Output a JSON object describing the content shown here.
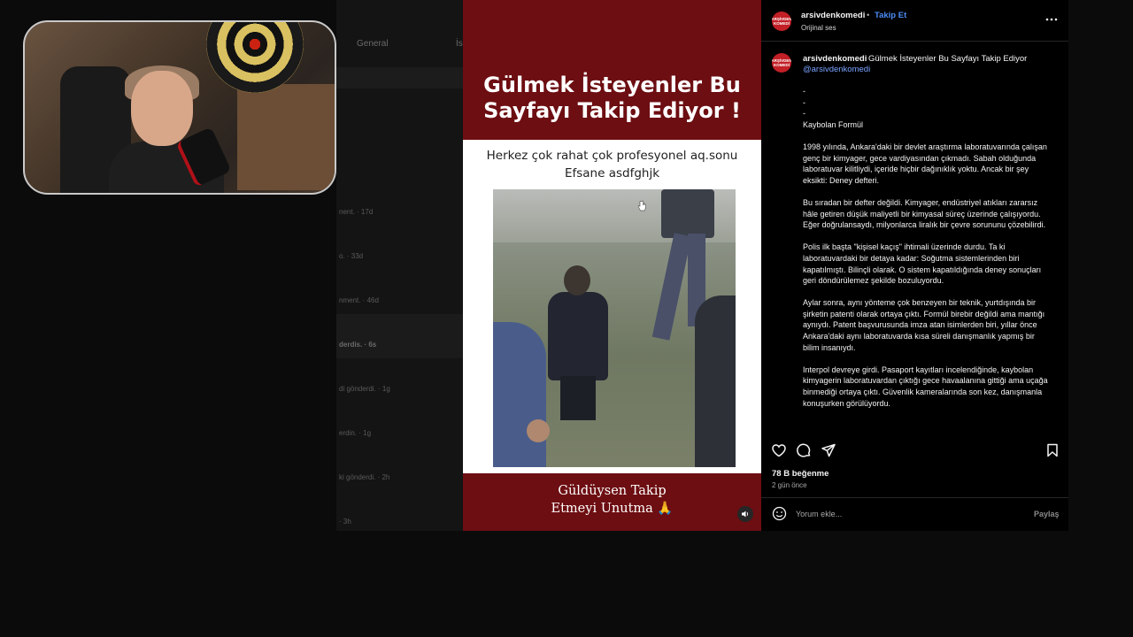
{
  "background": {
    "tabs": [
      "General",
      "İs"
    ],
    "notifications": [
      "nent. · 17d",
      "o. · 33d",
      "nment. · 46d",
      "derdis. · 6s",
      "di gönderdi. · 1g",
      "erdin. · 1g",
      "ki gönderdi. · 2h",
      "· 3h"
    ]
  },
  "post": {
    "title_line1": "Gülmek İsteyenler Bu",
    "title_line2": "Sayfayı Takip Ediyor !",
    "caption_line1": "Herkez çok rahat çok profesyonel aq.sonu",
    "caption_line2": "Efsane asdfghjk",
    "cta_line1": "Güldüysen Takip",
    "cta_line2": "Etmeyi Unutma 🙏",
    "mute_icon": "speaker-icon"
  },
  "sidebar": {
    "header": {
      "username": "arsivdenkomedi",
      "separator": "•",
      "follow_label": "Takip Et",
      "audio_label": "Orijinal ses",
      "avatar_text": "ARŞİVDEN KOMEDİ"
    },
    "caption": {
      "username": "arsivdenkomedi",
      "headline": "Gülmek İsteyenler Bu Sayfayı Takip Ediyor",
      "mention": "@arsivdenkomedi",
      "dashes": [
        "-",
        "-",
        "-"
      ],
      "title": "Kaybolan Formül",
      "paragraphs": [
        "1998 yılında, Ankara'daki bir devlet araştırma laboratuvarında çalışan genç bir kimyager, gece vardiyasından çıkmadı. Sabah olduğunda laboratuvar kilitliydi, içeride hiçbir dağınıklık yoktu. Ancak bir şey eksikti: Deney defteri.",
        "Bu sıradan bir defter değildi. Kimyager, endüstriyel atıkları zararsız hâle getiren düşük maliyetli bir kimyasal süreç üzerinde çalışıyordu. Eğer doğrulansaydı, milyonlarca liralık bir çevre sorununu çözebilirdi.",
        "Polis ilk başta \"kişisel kaçış\" ihtimali üzerinde durdu. Ta ki laboratuvardaki bir detaya kadar: Soğutma sistemlerinden biri kapatılmıştı. Bilinçli olarak. O sistem kapatıldığında deney sonuçları geri döndürülemez şekilde bozuluyordu.",
        "Aylar sonra, aynı yönteme çok benzeyen bir teknik, yurtdışında bir şirketin patenti olarak ortaya çıktı. Formül birebir değildi ama mantığı aynıydı. Patent başvurusunda imza atan isimlerden biri, yıllar önce Ankara'daki aynı laboratuvarda kısa süreli danışmanlık yapmış bir bilim insanıydı.",
        "Interpol devreye girdi. Pasaport kayıtları incelendiğinde, kaybolan kimyagerin laboratuvardan çıktığı gece havaalanına gittiği ama uçağa binmediği ortaya çıktı. Güvenlik kameralarında son kez, danışmanla konuşurken görülüyordu."
      ]
    },
    "actions": {
      "like_icon": "heart-icon",
      "comment_icon": "comment-icon",
      "share_icon": "send-icon",
      "save_icon": "bookmark-icon"
    },
    "likes": "78 B beğenme",
    "time": "2 gün önce",
    "comment_placeholder": "Yorum ekle...",
    "share_label": "Paylaş"
  },
  "colors": {
    "brand_red": "#6d0e12",
    "link_blue": "#4c8cf5",
    "panel_bg": "#000000"
  }
}
